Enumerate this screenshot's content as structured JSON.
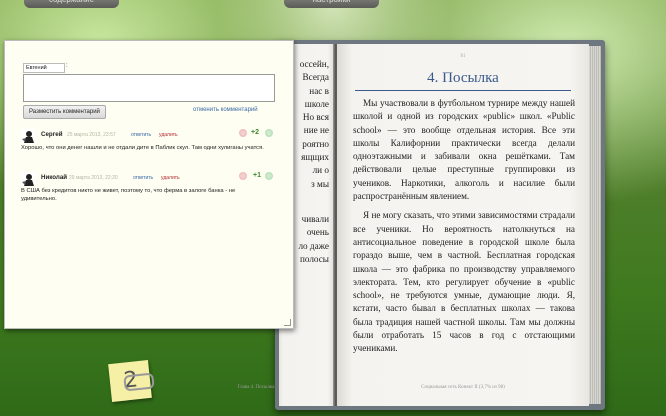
{
  "tabs": [
    "содержание",
    "настройки"
  ],
  "book": {
    "left_page_fragments": [
      "оссейн,",
      "Всегда",
      "нас в",
      "школе",
      "Но вся",
      "ние не",
      "роятно",
      "ящщих",
      "ли о",
      "з мы",
      "",
      "чивали",
      "очень",
      "ло даже",
      "полосы"
    ],
    "left_footer": "Глава 4. Посылка",
    "right_page_number": "81",
    "chapter_title": "4. Посылка",
    "paragraphs": [
      "Мы участвовали в футбольном турнире между нашей школой и одной из городских «public» школ. «Public school» — это вообще отдельная история. Все эти школы Калифорнии практически всегда делали одноэтажными и забивали окна решётками. Там действовали целые преступные группировки из учеников. Наркотики, алкоголь и насилие были распространённым явлением.",
      "Я не могу сказать, что этими зависимостями страдали все ученики. Но вероятность натолкнуться на антисоциальное поведение в городской школе была гораздо выше, чем в частной. Бесплатная городская школа — это фабрика по производству управляемого электората. Тем, кто регулирует обучение в «public school», не требуются умные, думающие люди. Я, кстати, часто бывал в бесплатных школах — такова была традиция нашей частной школы. Там мы должны были отработать 15 часов в год с отстающими учениками."
    ],
    "right_footer": "Социальная сеть Конект II (3,7% из 98)"
  },
  "comments_panel": {
    "name_value": "Евгений",
    "comment_text": "",
    "submit_label": "Разместить комментарий",
    "cancel_label": "отменить комментарий",
    "comments": [
      {
        "author": "Сергей",
        "date": "25 марта 2013, 23:57",
        "reply": "ответить",
        "delete": "удалить",
        "score": "+2",
        "text": "Хорошо, что они денег нашли и не отдали дите в Паблик скул. Там одни хулиганы учатся."
      },
      {
        "author": "Николай",
        "date": "29 марта 2013, 22:20",
        "reply": "ответить",
        "delete": "удалить",
        "score": "+1",
        "text": "В США без кредитов никто не живет, поэтому то, что ферма в залоге банка - не удивительно."
      }
    ]
  },
  "sticky_note": {
    "count": "2"
  }
}
